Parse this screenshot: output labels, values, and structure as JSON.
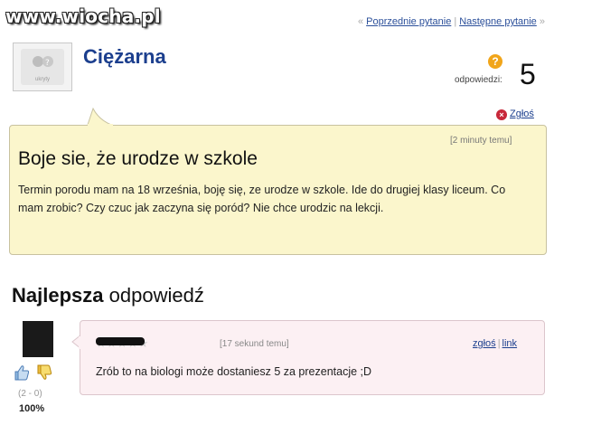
{
  "watermark": "www.wiocha.pl",
  "nav": {
    "prev": "Poprzednie pytanie",
    "next": "Następne pytanie"
  },
  "question": {
    "author": "Ciężarna",
    "answers_label": "odpowiedzi:",
    "answers_count": "5",
    "report": "Zgłoś",
    "time": "[2 minuty temu]",
    "title": "Boje sie, że urodze w szkole",
    "body": "Termin porodu mam na 18 września, boję się, ze urodze w szkole. Ide do drugiej klasy liceum. Co mam zrobic? Czy czuc jak zaczyna się poród? Nie chce urodzic na lekcji.",
    "avatar_caption": "ukryty"
  },
  "best_answer": {
    "heading_bold": "Najlepsza",
    "heading_rest": "odpowiedź",
    "votes": "(2 - 0)",
    "percent": "100%",
    "stars": "★★★★★",
    "time": "[17 sekund temu]",
    "report": "zgłoś",
    "link": "link",
    "body": "Zrób to na biologi może dostaniesz 5 za prezentacje ;D"
  },
  "colors": {
    "question_bg": "#fbf6cc",
    "answer_bg": "#fcf0f3",
    "link": "#1c3f8e",
    "count_badge": "#f1a51a"
  },
  "icons": {
    "question_avatar": "placeholder-avatar-icon",
    "count_badge": "question-mark-icon",
    "report": "x-circle-icon",
    "thumb_up": "thumb-up-icon",
    "thumb_down": "thumb-down-icon"
  }
}
